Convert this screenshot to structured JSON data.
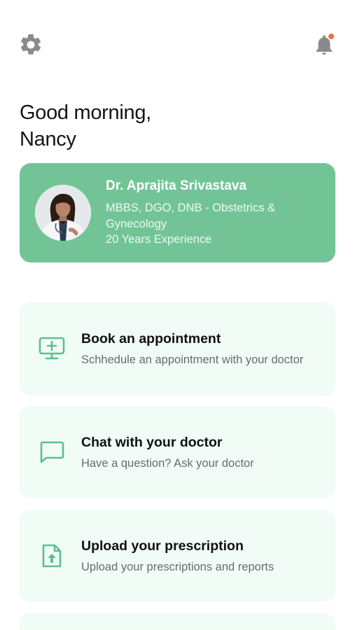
{
  "header": {
    "settings_icon": "gear-icon",
    "notification_icon": "bell-icon",
    "notification_badge_color": "#f0703f"
  },
  "greeting": {
    "line1": "Good morning,",
    "line2": "Nancy"
  },
  "doctor": {
    "name": "Dr. Aprajita Srivastava",
    "qualification": "MBBS, DGO, DNB - Obstetrics & Gynecology",
    "experience": "20 Years Experience",
    "card_color": "#72c497"
  },
  "actions": [
    {
      "title": "Book an appointment",
      "subtitle": "Schhedule an appointment with your doctor",
      "icon": "monitor-plus-icon"
    },
    {
      "title": "Chat with your doctor",
      "subtitle": "Have a question? Ask your doctor",
      "icon": "chat-bubble-icon"
    },
    {
      "title": "Upload your prescription",
      "subtitle": "Upload your prescriptions and reports",
      "icon": "file-upload-icon"
    }
  ],
  "colors": {
    "accent": "#5cbf8c",
    "card_background": "#f1fcf7",
    "icon_gray": "#8a8a8a"
  }
}
